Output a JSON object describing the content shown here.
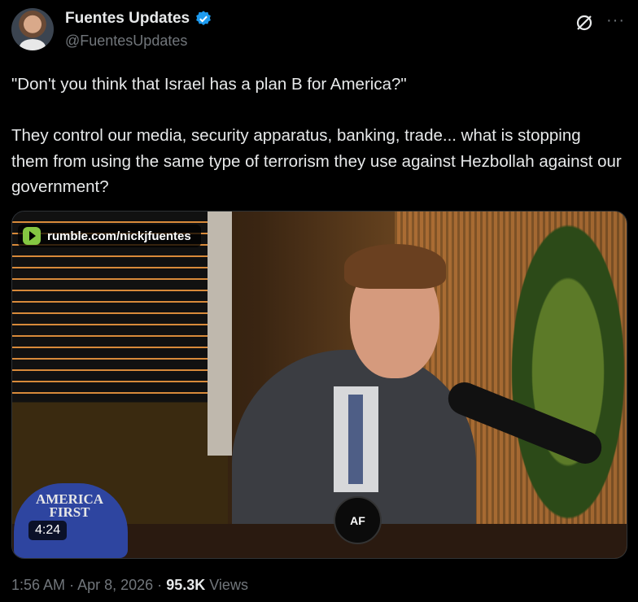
{
  "author": {
    "display_name": "Fuentes Updates",
    "handle": "@FuentesUpdates",
    "verified_icon": "verified-badge-icon"
  },
  "actions": {
    "grok_icon": "grok-icon",
    "more_label": "···"
  },
  "tweet": {
    "text": "\"Don't you think that Israel has a plan B for America?\"\n\nThey control our media, security apparatus, banking, trade... what is stopping them from using the same type of terrorism they use against Hezbollah against our government?"
  },
  "media": {
    "source_label": "rumble.com/nickjfuentes",
    "duration": "4:24",
    "hat_text": "AMERICA FIRST",
    "mic_logo": "AF"
  },
  "meta": {
    "time": "1:56 AM",
    "date": "Apr 8, 2026",
    "separator": "·",
    "views_count": "95.3K",
    "views_label": "Views"
  },
  "colors": {
    "background": "#000000",
    "text": "#e7e9ea",
    "secondary": "#71767b",
    "verified": "#1d9bf0",
    "rumble": "#85c742"
  }
}
